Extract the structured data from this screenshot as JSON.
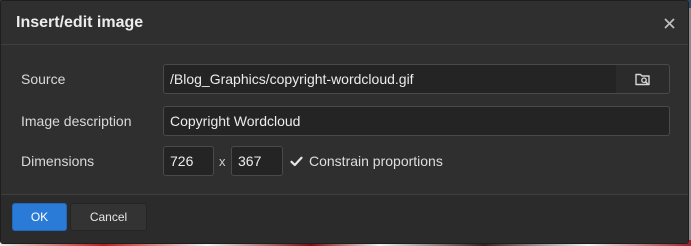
{
  "dialog": {
    "title": "Insert/edit image",
    "close_icon": "close-icon"
  },
  "source": {
    "label": "Source",
    "value": "/Blog_Graphics/copyright-wordcloud.gif",
    "browse_icon": "browse-folder-icon"
  },
  "description": {
    "label": "Image description",
    "value": "Copyright Wordcloud"
  },
  "dimensions": {
    "label": "Dimensions",
    "width": "726",
    "height": "367",
    "separator": "x",
    "constrain_checked": true,
    "constrain_label": "Constrain proportions"
  },
  "footer": {
    "ok_label": "OK",
    "cancel_label": "Cancel"
  },
  "colors": {
    "dialog_bg": "#2f2f2f",
    "input_bg": "#242424",
    "primary": "#2a7bd8"
  }
}
